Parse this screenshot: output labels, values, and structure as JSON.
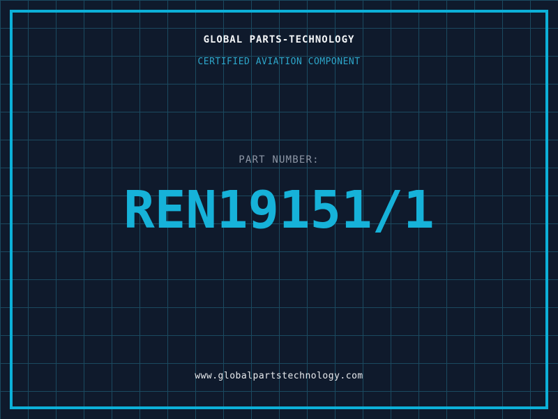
{
  "header": {
    "company_name": "GLOBAL PARTS-TECHNOLOGY",
    "subtitle": "CERTIFIED AVIATION COMPONENT"
  },
  "part": {
    "label": "PART NUMBER:",
    "number": "REN19151/1"
  },
  "footer": {
    "website": "www.globalpartstechnology.com"
  },
  "colors": {
    "background": "#0f1a2c",
    "grid_line": "#1b4a60",
    "frame": "#0cb0d8",
    "part_number_cyan": "#16b2d9",
    "subtitle_cyan": "#2da7cb",
    "title_white": "#f4f6f8",
    "label_gray": "#8e97a6",
    "footer_text": "#e8ebee"
  }
}
